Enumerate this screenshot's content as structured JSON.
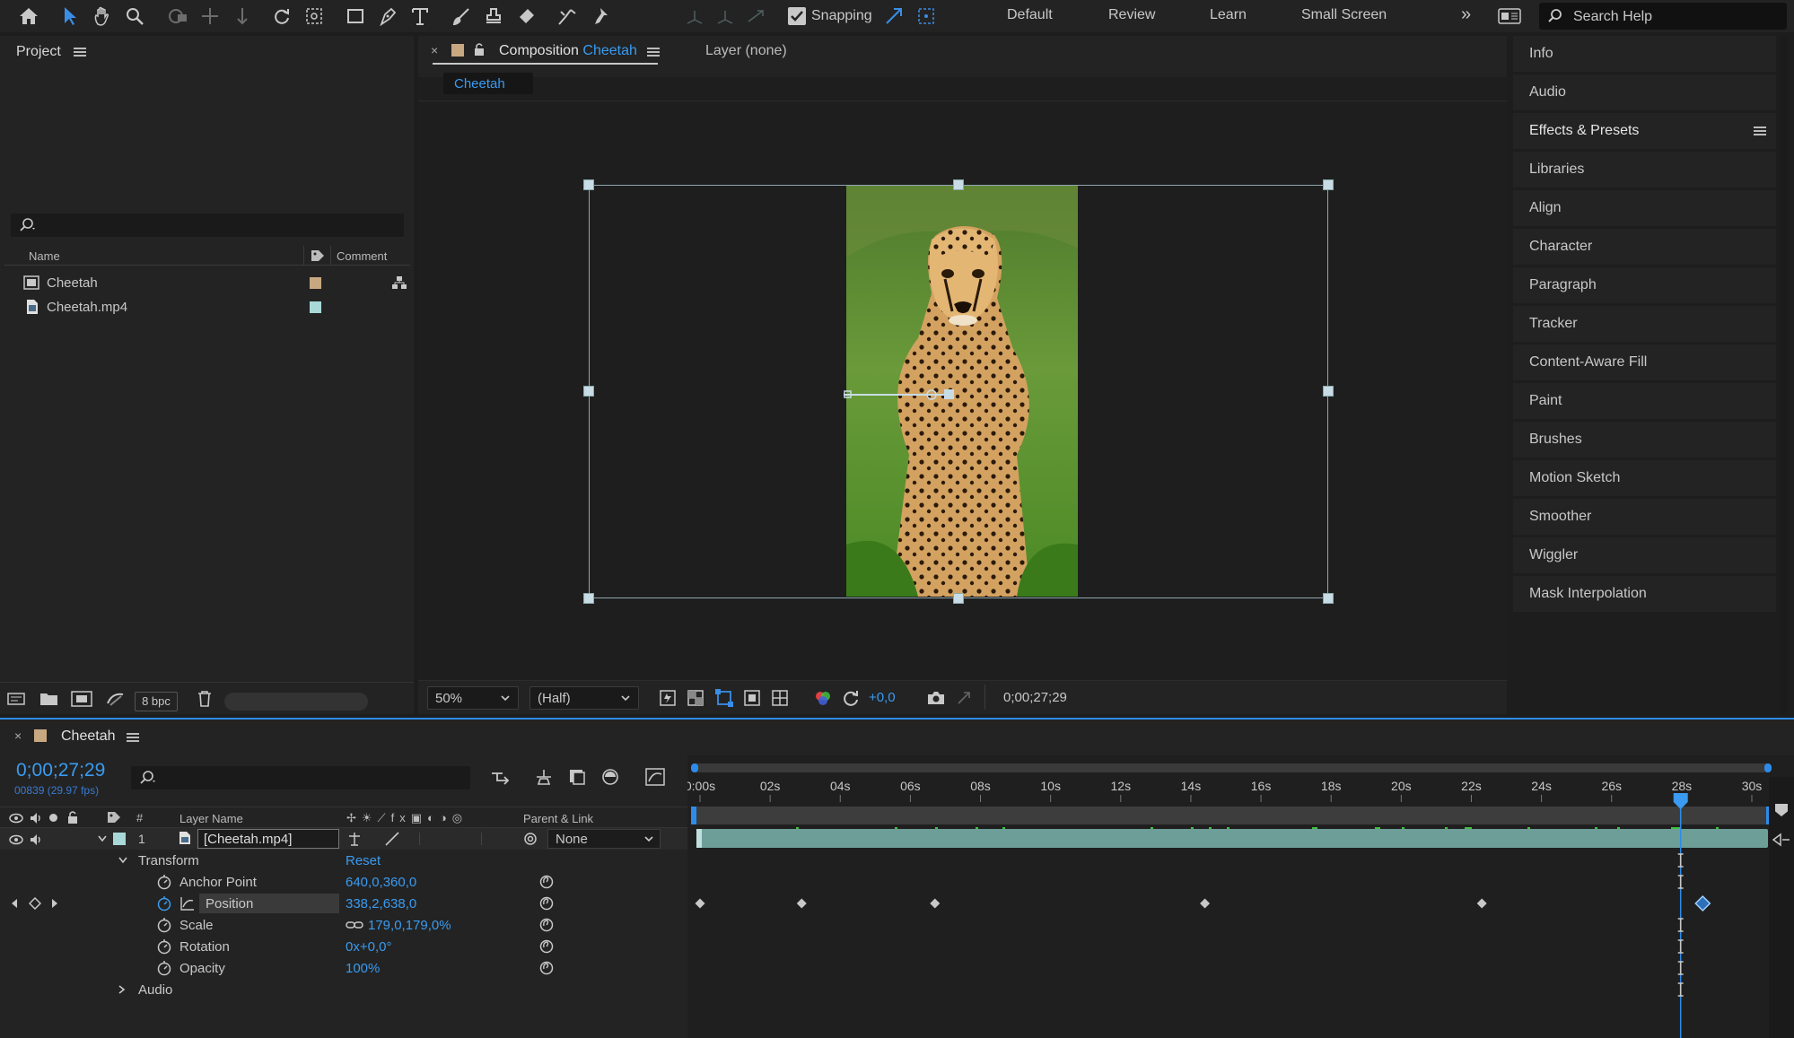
{
  "toolbar": {
    "snapping_label": "Snapping",
    "workspaces": [
      "Default",
      "Review",
      "Learn",
      "Small Screen"
    ],
    "search_placeholder": "Search Help"
  },
  "project": {
    "title": "Project",
    "columns": {
      "name": "Name",
      "comment": "Comment"
    },
    "items": [
      {
        "name": "Cheetah",
        "color": "#c8a880"
      },
      {
        "name": "Cheetah.mp4",
        "color": "#a8d8d8"
      }
    ],
    "bpc_label": "8 bpc"
  },
  "composition": {
    "tab_prefix": "Composition",
    "tab_name": "Cheetah",
    "layer_tab": "Layer (none)",
    "breadcrumb": "Cheetah",
    "zoom": "50%",
    "resolution": "(Half)",
    "exposure": "+0,0",
    "timecode": "0;00;27;29"
  },
  "right_panels": [
    "Info",
    "Audio",
    "Effects & Presets",
    "Libraries",
    "Align",
    "Character",
    "Paragraph",
    "Tracker",
    "Content-Aware Fill",
    "Paint",
    "Brushes",
    "Motion Sketch",
    "Smoother",
    "Wiggler",
    "Mask Interpolation"
  ],
  "timeline": {
    "tab_name": "Cheetah",
    "current_time": "0;00;27;29",
    "frame_info": "00839 (29.97 fps)",
    "columns": {
      "num": "#",
      "layer_name": "Layer Name",
      "parent": "Parent & Link"
    },
    "layer": {
      "index": "1",
      "name": "[Cheetah.mp4]",
      "parent": "None"
    },
    "transform_label": "Transform",
    "reset_label": "Reset",
    "properties": [
      {
        "name": "Anchor Point",
        "value": "640,0,360,0"
      },
      {
        "name": "Position",
        "value": "338,2,638,0"
      },
      {
        "name": "Scale",
        "value": "179,0,179,0%"
      },
      {
        "name": "Rotation",
        "value": "0x+0,0°"
      },
      {
        "name": "Opacity",
        "value": "100%"
      }
    ],
    "audio_label": "Audio",
    "ruler_ticks": [
      "0:00s",
      "02s",
      "04s",
      "06s",
      "08s",
      "10s",
      "12s",
      "14s",
      "16s",
      "18s",
      "20s",
      "22s",
      "24s",
      "26s",
      "28s",
      "30s"
    ],
    "playhead_seconds": 27.97,
    "duration_seconds": 30,
    "position_keyframes_seconds": [
      0,
      2.9,
      6.7,
      14.4,
      22.3,
      28.6
    ]
  }
}
